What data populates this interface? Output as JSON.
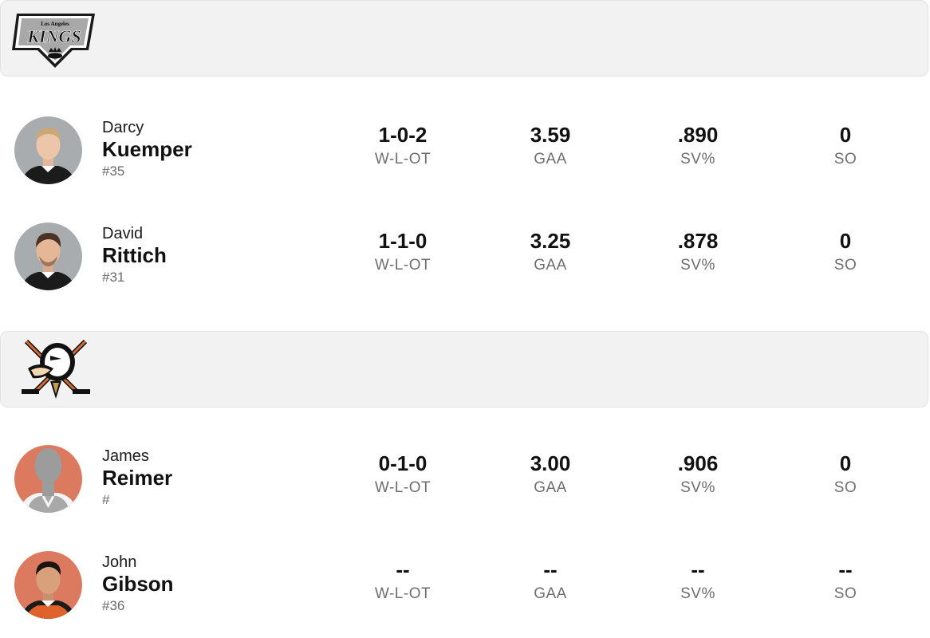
{
  "teams": [
    {
      "logo_icon": "la-kings-logo-icon",
      "logo_text_small": "Los Angeles",
      "logo_text_big": "KINGS",
      "header_color": "#f2f2f2"
    },
    {
      "logo_icon": "anaheim-ducks-logo-icon",
      "header_color": "#f2f2f2"
    }
  ],
  "stat_labels": {
    "record": "W-L-OT",
    "gaa": "GAA",
    "sv": "SV%",
    "so": "SO"
  },
  "goalies": [
    {
      "first": "Darcy",
      "last": "Kuemper",
      "number": "#35",
      "record": "1-0-2",
      "gaa": "3.59",
      "sv": ".890",
      "so": "0",
      "avatar_bg": "#a9acaf"
    },
    {
      "first": "David",
      "last": "Rittich",
      "number": "#31",
      "record": "1-1-0",
      "gaa": "3.25",
      "sv": ".878",
      "so": "0",
      "avatar_bg": "#a9acaf"
    },
    {
      "first": "James",
      "last": "Reimer",
      "number": "#",
      "record": "0-1-0",
      "gaa": "3.00",
      "sv": ".906",
      "so": "0",
      "avatar_bg": "#dc7a5f"
    },
    {
      "first": "John",
      "last": "Gibson",
      "number": "#36",
      "record": "--",
      "gaa": "--",
      "sv": "--",
      "so": "--",
      "avatar_bg": "#dc7a5f"
    }
  ]
}
